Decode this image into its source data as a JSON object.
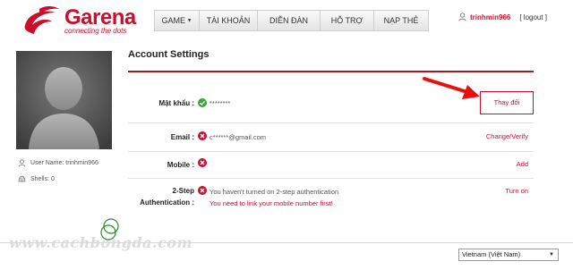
{
  "brand": {
    "name": "Garena",
    "tagline": "connecting the dots",
    "color": "#c8102e"
  },
  "nav": {
    "items": [
      {
        "label": "GAME",
        "has_dropdown": true
      },
      {
        "label": "TÀI KHOẢN"
      },
      {
        "label": "DIỄN ĐÀN"
      },
      {
        "label": "HỖ TRỢ"
      },
      {
        "label": "NẠP THẺ"
      }
    ]
  },
  "user": {
    "name": "trinhmin966",
    "logout_label": "[ logout ]"
  },
  "sidebar": {
    "username_label": "User Name: trinhmin966",
    "shells_label": "Shells: 0"
  },
  "page": {
    "title": "Account Settings"
  },
  "settings": {
    "password": {
      "label": "Mật khẩu :",
      "status": "ok",
      "value": "********",
      "action": "Thay đổi"
    },
    "email": {
      "label": "Email :",
      "status": "error",
      "value": "c******@gmail.com",
      "action": "Change/Verify"
    },
    "mobile": {
      "label": "Mobile :",
      "status": "error",
      "value": "",
      "action": "Add"
    },
    "two_step": {
      "label_line1": "2-Step",
      "label_line2": "Authentication :",
      "status": "error",
      "value_line1": "You haven't turned on 2-step authentication",
      "value_line2": "You need to link your mobile number first!",
      "action": "Turn on"
    }
  },
  "watermark": "www.cachbongda.com",
  "footer": {
    "language": "Vietnam (Việt Nam)"
  },
  "colors": {
    "accent": "#c8102e",
    "ok": "#3aa335",
    "rule": "#a01c24"
  }
}
